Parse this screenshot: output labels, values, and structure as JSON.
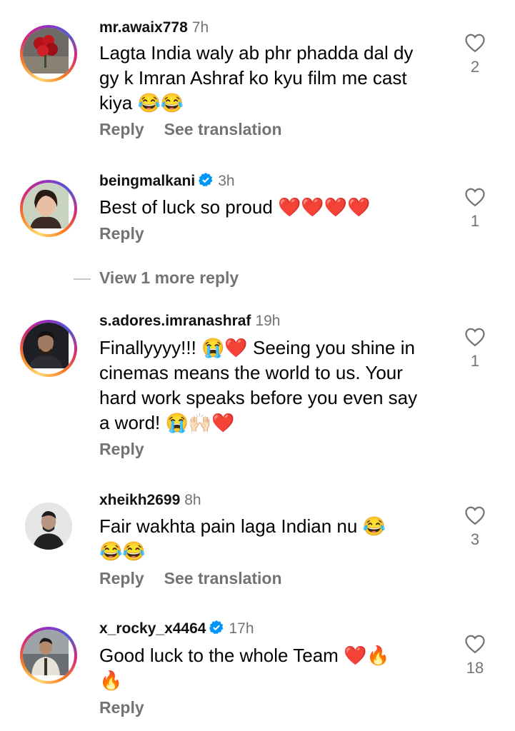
{
  "comments": [
    {
      "username": "mr.awaix778",
      "verified": false,
      "time": "7h",
      "text": "Lagta India waly ab phr phadda dal dy gy k Imran Ashraf ko kyu film me cast kiya 😂😂",
      "reply_label": "Reply",
      "translate_label": "See translation",
      "likes": "2"
    },
    {
      "username": "beingmalkani",
      "verified": true,
      "time": "3h",
      "text": "Best of luck so proud ❤️❤️❤️❤️",
      "reply_label": "Reply",
      "likes": "1"
    },
    {
      "username": "s.adores.imranashraf",
      "verified": false,
      "time": "19h",
      "text": "Finallyyyy!!! 😭❤️ Seeing you shine in cinemas  means the world to us. Your hard work speaks before you even say a word! 😭🙌🏻❤️",
      "reply_label": "Reply",
      "likes": "1"
    },
    {
      "username": "xheikh2699",
      "verified": false,
      "time": "8h",
      "text": "Fair wakhta pain laga Indian nu 😂 😂😂",
      "reply_label": "Reply",
      "translate_label": "See translation",
      "likes": "3"
    },
    {
      "username": "x_rocky_x4464",
      "verified": true,
      "time": "17h",
      "text": "Good luck to the whole Team ❤️🔥 🔥",
      "reply_label": "Reply",
      "likes": "18"
    }
  ],
  "view_more_replies": "View 1 more reply",
  "colors": {
    "secondary_text": "#737373",
    "verified_blue": "#0095f6"
  }
}
